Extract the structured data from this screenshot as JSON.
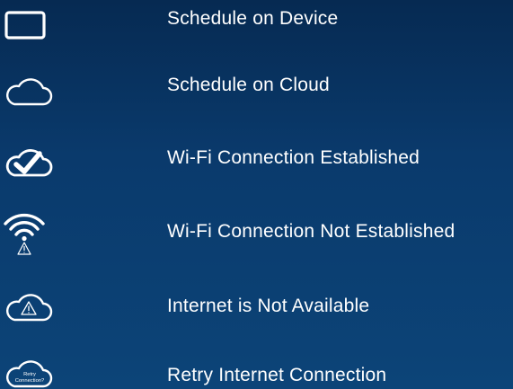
{
  "legend": {
    "items": [
      {
        "icon": "device-icon",
        "label": "Schedule on Device"
      },
      {
        "icon": "cloud-icon",
        "label": "Schedule on Cloud"
      },
      {
        "icon": "cloud-check-icon",
        "label": "Wi-Fi Connection Established"
      },
      {
        "icon": "wifi-warning-icon",
        "label": "Wi-Fi Connection Not Established"
      },
      {
        "icon": "cloud-warning-icon",
        "label": "Internet is Not Available"
      },
      {
        "icon": "cloud-retry-icon",
        "label": "Retry Internet Connection",
        "icon_text_line1": "Retry",
        "icon_text_line2": "Connection?"
      }
    ]
  },
  "colors": {
    "background_top": "#062a52",
    "background_bottom": "#0c4478",
    "foreground": "#ffffff"
  }
}
